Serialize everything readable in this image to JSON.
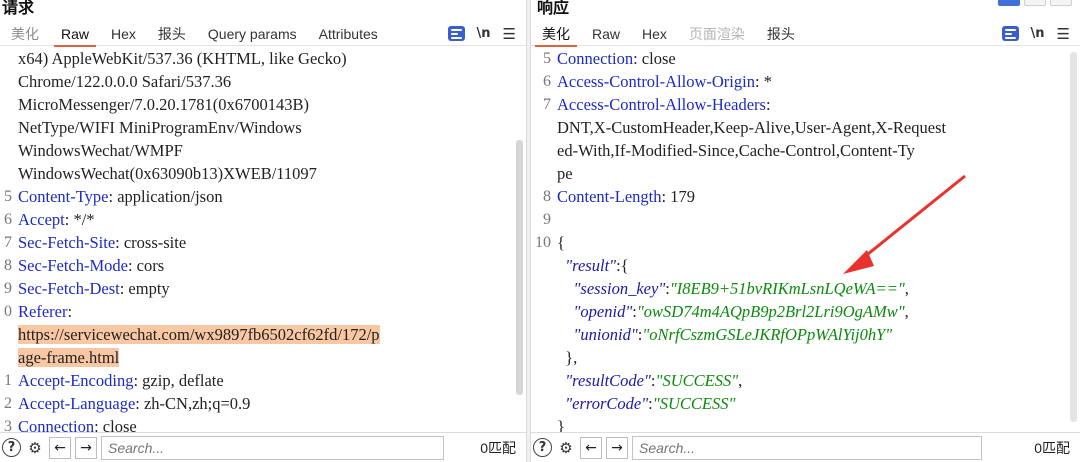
{
  "request": {
    "title": "请求",
    "tabs": [
      {
        "label": "美化",
        "state": "dim"
      },
      {
        "label": "Raw",
        "state": "active"
      },
      {
        "label": "Hex",
        "state": "normal"
      },
      {
        "label": "报头",
        "state": "normal"
      },
      {
        "label": "Query params",
        "state": "normal"
      },
      {
        "label": "Attributes",
        "state": "normal"
      }
    ],
    "newline_label": "\\n",
    "lines": [
      {
        "ln": "",
        "parts": [
          {
            "t": "x64) AppleWebKit/537.36 (KHTML, like Gecko)",
            "c": "val"
          }
        ]
      },
      {
        "ln": "",
        "parts": [
          {
            "t": "Chrome/122.0.0.0 Safari/537.36",
            "c": "val"
          }
        ]
      },
      {
        "ln": "",
        "parts": [
          {
            "t": "MicroMessenger/7.0.20.1781(0x6700143B)",
            "c": "val"
          }
        ]
      },
      {
        "ln": "",
        "parts": [
          {
            "t": "NetType/WIFI MiniProgramEnv/Windows",
            "c": "val"
          }
        ]
      },
      {
        "ln": "",
        "parts": [
          {
            "t": "WindowsWechat/WMPF",
            "c": "val"
          }
        ]
      },
      {
        "ln": "",
        "parts": [
          {
            "t": "WindowsWechat(0x63090b13)XWEB/11097",
            "c": "val"
          }
        ]
      },
      {
        "ln": "5",
        "parts": [
          {
            "t": "Content-Type",
            "c": "key"
          },
          {
            "t": ": application/json",
            "c": "val"
          }
        ]
      },
      {
        "ln": "6",
        "parts": [
          {
            "t": "Accept",
            "c": "key"
          },
          {
            "t": ": */*",
            "c": "val"
          }
        ]
      },
      {
        "ln": "7",
        "parts": [
          {
            "t": "Sec-Fetch-Site",
            "c": "key"
          },
          {
            "t": ": cross-site",
            "c": "val"
          }
        ]
      },
      {
        "ln": "8",
        "parts": [
          {
            "t": "Sec-Fetch-Mode",
            "c": "key"
          },
          {
            "t": ": cors",
            "c": "val"
          }
        ]
      },
      {
        "ln": "9",
        "parts": [
          {
            "t": "Sec-Fetch-Dest",
            "c": "key"
          },
          {
            "t": ": empty",
            "c": "val"
          }
        ]
      },
      {
        "ln": "0",
        "parts": [
          {
            "t": "Referer",
            "c": "key"
          },
          {
            "t": ":",
            "c": "val"
          }
        ]
      },
      {
        "ln": "",
        "parts": [
          {
            "t": "https://servicewechat.com/wx9897fb6502cf62fd/172/p",
            "c": "hl"
          }
        ]
      },
      {
        "ln": "",
        "parts": [
          {
            "t": "age-frame.html",
            "c": "hl"
          }
        ]
      },
      {
        "ln": "1",
        "parts": [
          {
            "t": "Accept-Encoding",
            "c": "key"
          },
          {
            "t": ": gzip, deflate",
            "c": "val"
          }
        ]
      },
      {
        "ln": "2",
        "parts": [
          {
            "t": "Accept-Language",
            "c": "key"
          },
          {
            "t": ": zh-CN,zh;q=0.9",
            "c": "val"
          }
        ]
      },
      {
        "ln": "3",
        "parts": [
          {
            "t": "Connection",
            "c": "key"
          },
          {
            "t": ": close",
            "c": "val"
          }
        ]
      }
    ],
    "search_placeholder": "Search...",
    "match_text": "0匹配"
  },
  "response": {
    "title": "响应",
    "tabs": [
      {
        "label": "美化",
        "state": "active"
      },
      {
        "label": "Raw",
        "state": "normal"
      },
      {
        "label": "Hex",
        "state": "normal"
      },
      {
        "label": "页面渲染",
        "state": "disabled"
      },
      {
        "label": "报头",
        "state": "normal"
      }
    ],
    "newline_label": "\\n",
    "lines": [
      {
        "ln": "5",
        "parts": [
          {
            "t": "Connection",
            "c": "key"
          },
          {
            "t": ": close",
            "c": "val"
          }
        ]
      },
      {
        "ln": "6",
        "parts": [
          {
            "t": "Access-Control-Allow-Origin",
            "c": "key"
          },
          {
            "t": ": *",
            "c": "val"
          }
        ]
      },
      {
        "ln": "7",
        "parts": [
          {
            "t": "Access-Control-Allow-Headers",
            "c": "key"
          },
          {
            "t": ":",
            "c": "val"
          }
        ]
      },
      {
        "ln": "",
        "parts": [
          {
            "t": "DNT,X-CustomHeader,Keep-Alive,User-Agent,X-Request",
            "c": "val"
          }
        ]
      },
      {
        "ln": "",
        "parts": [
          {
            "t": "ed-With,If-Modified-Since,Cache-Control,Content-Ty",
            "c": "val"
          }
        ]
      },
      {
        "ln": "",
        "parts": [
          {
            "t": "pe",
            "c": "val"
          }
        ]
      },
      {
        "ln": "8",
        "parts": [
          {
            "t": "Content-Length",
            "c": "key"
          },
          {
            "t": ": 179",
            "c": "val"
          }
        ]
      },
      {
        "ln": "9",
        "parts": []
      },
      {
        "ln": "10",
        "parts": [
          {
            "t": "{",
            "c": "jp"
          }
        ]
      },
      {
        "ln": "",
        "parts": [
          {
            "t": "  \"result\"",
            "c": "jk"
          },
          {
            "t": ":{",
            "c": "jp"
          }
        ]
      },
      {
        "ln": "",
        "parts": [
          {
            "t": "    \"session_key\"",
            "c": "jk"
          },
          {
            "t": ":",
            "c": "jp"
          },
          {
            "t": "\"I8EB9+51bvRIKmLsnLQeWA==\"",
            "c": "jv"
          },
          {
            "t": ",",
            "c": "jp"
          }
        ]
      },
      {
        "ln": "",
        "parts": [
          {
            "t": "    \"openid\"",
            "c": "jk"
          },
          {
            "t": ":",
            "c": "jp"
          },
          {
            "t": "\"owSD74m4AQpB9p2Brl2Lri9OgAMw\"",
            "c": "jv"
          },
          {
            "t": ",",
            "c": "jp"
          }
        ]
      },
      {
        "ln": "",
        "parts": [
          {
            "t": "    \"unionid\"",
            "c": "jk"
          },
          {
            "t": ":",
            "c": "jp"
          },
          {
            "t": "\"oNrfCszmGSLeJKRfOPpWAlYij0hY\"",
            "c": "jv"
          }
        ]
      },
      {
        "ln": "",
        "parts": [
          {
            "t": "  },",
            "c": "jp"
          }
        ]
      },
      {
        "ln": "",
        "parts": [
          {
            "t": "  \"resultCode\"",
            "c": "jk"
          },
          {
            "t": ":",
            "c": "jp"
          },
          {
            "t": "\"SUCCESS\"",
            "c": "jv"
          },
          {
            "t": ",",
            "c": "jp"
          }
        ]
      },
      {
        "ln": "",
        "parts": [
          {
            "t": "  \"errorCode\"",
            "c": "jk"
          },
          {
            "t": ":",
            "c": "jp"
          },
          {
            "t": "\"SUCCESS\"",
            "c": "jv"
          }
        ]
      },
      {
        "ln": "",
        "parts": [
          {
            "t": "}",
            "c": "jp"
          }
        ]
      }
    ],
    "search_placeholder": "Search...",
    "match_text": "0匹配"
  },
  "colors": {
    "accent": "#e2603a",
    "header_key": "#1c2bc4",
    "json_key": "#1a1aa6",
    "json_value": "#0b8a0b",
    "highlight": "#f9c7a3",
    "annotation_arrow": "#e8322e"
  }
}
